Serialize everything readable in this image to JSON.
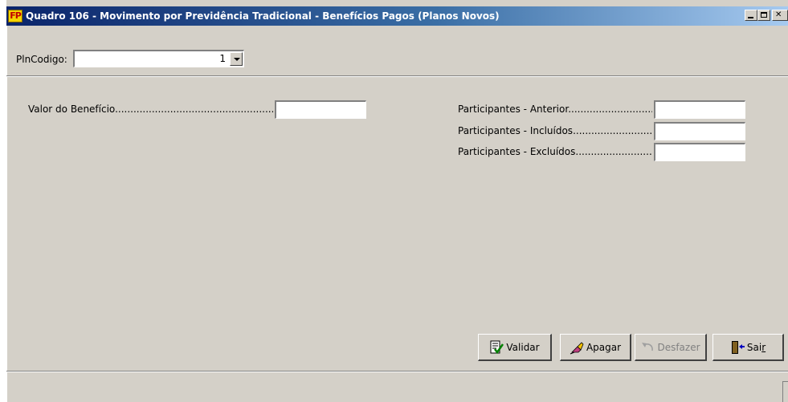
{
  "window": {
    "app_icon_text": "FP",
    "title": "Quadro 106 - Movimento por Previdência Tradicional - Benefícios Pagos (Planos Novos)",
    "controls": [
      "minimize",
      "maximize",
      "close"
    ]
  },
  "plano": {
    "label": "PlnCodigo:",
    "value": "1"
  },
  "form": {
    "valor_beneficio": {
      "label": "Valor do Benefício",
      "value": ""
    },
    "participantes_anterior": {
      "label": "Participantes - Anterior",
      "value": ""
    },
    "participantes_incluidos": {
      "label": "Participantes - Incluídos",
      "value": ""
    },
    "participantes_excluidos": {
      "label": "Participantes - Excluídos",
      "value": ""
    }
  },
  "buttons": {
    "validar": {
      "label": "Validar",
      "icon": "validate-checklist-icon"
    },
    "apagar": {
      "label": "Apagar",
      "icon": "eraser-icon"
    },
    "desfazer": {
      "label": "Desfazer",
      "icon": "undo-icon",
      "enabled": false
    },
    "sair": {
      "label_main": "Sai",
      "label_underlined": "r",
      "icon": "exit-door-icon"
    }
  },
  "colors": {
    "title_gradient_start": "#0a246a",
    "title_gradient_end": "#a6caf0",
    "face": "#d4d0c8"
  }
}
